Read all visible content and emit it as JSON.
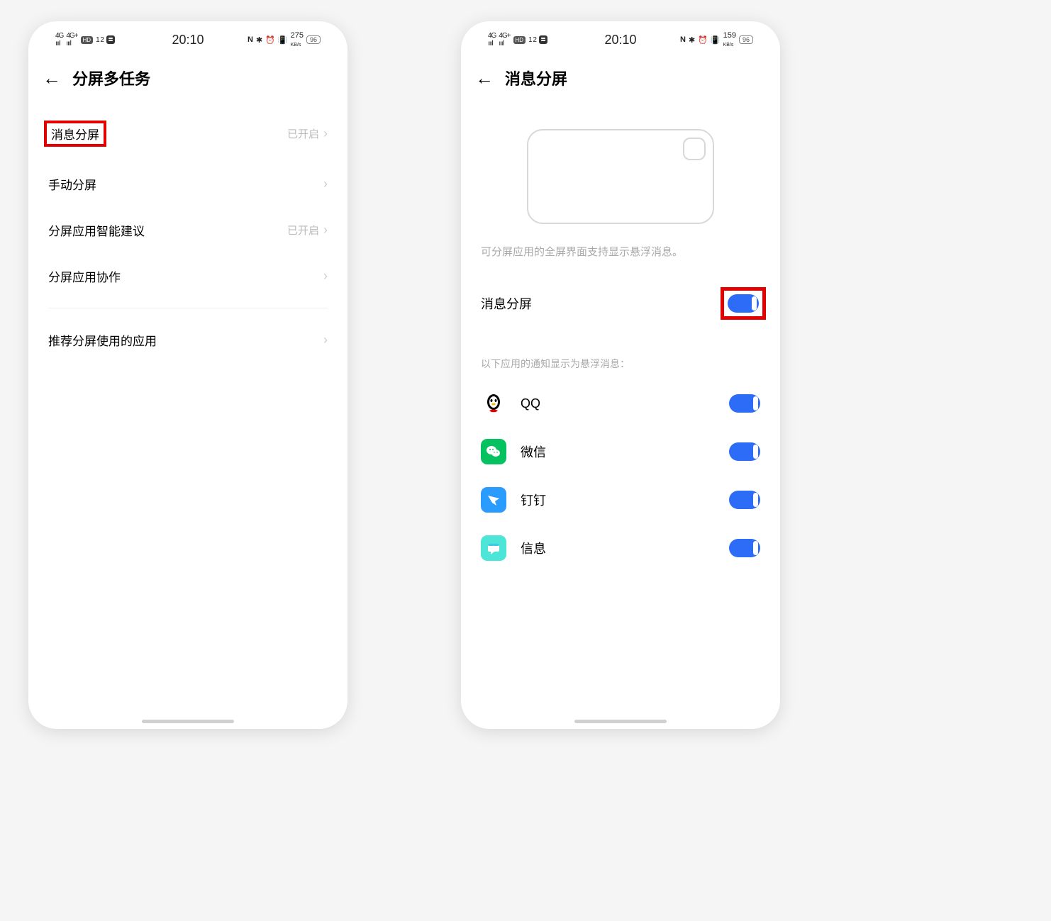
{
  "status": {
    "signal1": "4G",
    "signal2": "4G+",
    "hd": "HD",
    "hd_sub": "1 2",
    "time": "20:10",
    "nfc": "N",
    "speed": "275",
    "speed_unit": "KB/s",
    "speed2": "159",
    "battery": "96"
  },
  "phone1": {
    "title": "分屏多任务",
    "items": [
      {
        "label": "消息分屏",
        "value": "已开启",
        "highlighted": true
      },
      {
        "label": "手动分屏",
        "value": ""
      },
      {
        "label": "分屏应用智能建议",
        "value": "已开启"
      },
      {
        "label": "分屏应用协作",
        "value": ""
      }
    ],
    "item_recommend": "推荐分屏使用的应用"
  },
  "phone2": {
    "title": "消息分屏",
    "desc": "可分屏应用的全屏界面支持显示悬浮消息。",
    "main_toggle_label": "消息分屏",
    "section_label": "以下应用的通知显示为悬浮消息：",
    "apps": [
      {
        "name": "QQ",
        "icon": "qq"
      },
      {
        "name": "微信",
        "icon": "wechat"
      },
      {
        "name": "钉钉",
        "icon": "dingtalk"
      },
      {
        "name": "信息",
        "icon": "messages"
      }
    ]
  }
}
